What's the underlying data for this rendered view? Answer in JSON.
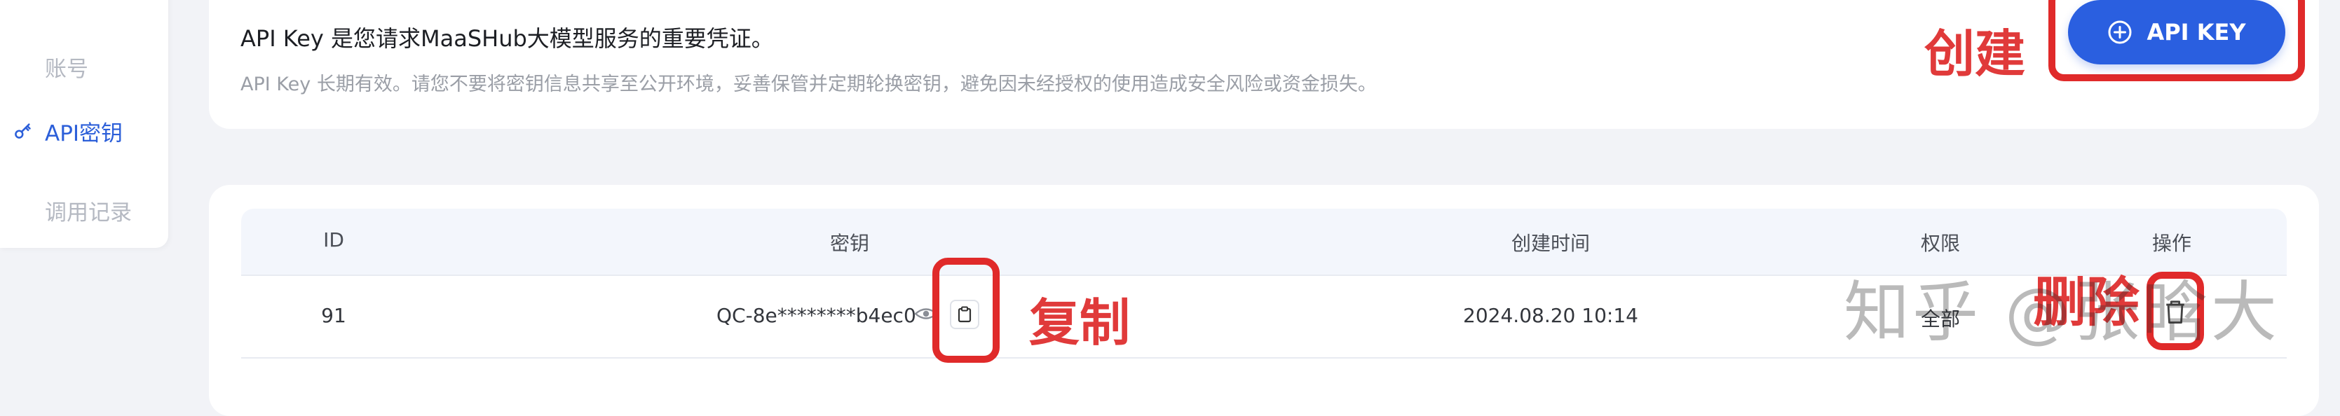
{
  "sidebar": {
    "items": [
      {
        "label": "账号",
        "active": false
      },
      {
        "label": "API密钥",
        "active": true
      },
      {
        "label": "调用记录",
        "active": false
      }
    ]
  },
  "apikey_info": {
    "title": "API Key 是您请求MaaSHub大模型服务的重要凭证。",
    "subtitle": "API Key 长期有效。请您不要将密钥信息共享至公开环境，妥善保管并定期轮换密钥，避免因未经授权的使用造成安全风险或资金损失。",
    "create_button_label": "API KEY"
  },
  "annotations": {
    "create_label": "创建",
    "copy_label": "复制",
    "delete_label": "删除"
  },
  "table": {
    "columns": [
      "ID",
      "密钥",
      "创建时间",
      "权限",
      "操作"
    ],
    "rows": [
      {
        "id": "91",
        "key": "QC-8e********b4ec0",
        "created": "2024.08.20 10:14",
        "permission": "全部"
      }
    ]
  },
  "watermark": "知乎 @张晗大",
  "colors": {
    "accent": "#2a5fe0",
    "annotation_red": "#e02a2a"
  }
}
